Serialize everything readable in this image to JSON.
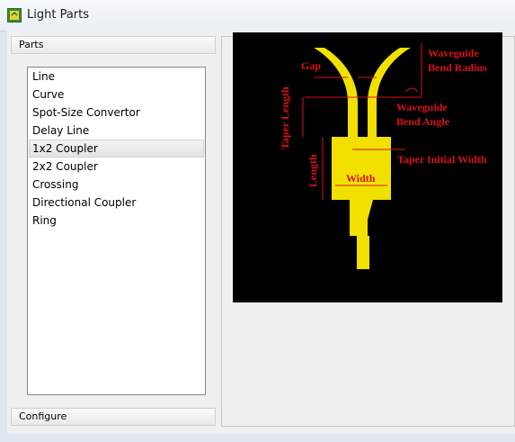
{
  "window": {
    "title": "Light Parts"
  },
  "left_panel": {
    "header": "Parts",
    "footer": "Configure",
    "parts": [
      {
        "label": "Line",
        "selected": false
      },
      {
        "label": "Curve",
        "selected": false
      },
      {
        "label": "Spot-Size Convertor",
        "selected": false
      },
      {
        "label": "Delay Line",
        "selected": false
      },
      {
        "label": "1x2 Coupler",
        "selected": true
      },
      {
        "label": "2x2 Coupler",
        "selected": false
      },
      {
        "label": "Crossing",
        "selected": false
      },
      {
        "label": "Directional Coupler",
        "selected": false
      },
      {
        "label": "Ring",
        "selected": false
      }
    ]
  },
  "diagram": {
    "labels": {
      "gap": "Gap",
      "waveguide_bend_radius_1": "Waveguide",
      "waveguide_bend_radius_2": "Bend Radius",
      "waveguide_bend_angle_1": "Waveguide",
      "waveguide_bend_angle_2": "Bend Angle",
      "taper_length": "Taper Length",
      "length": "Length",
      "width": "Width",
      "taper_initial_width": "Taper Initial Width"
    },
    "colors": {
      "background": "#000000",
      "waveguide": "#f2e000",
      "annotation": "#d8121a"
    }
  }
}
